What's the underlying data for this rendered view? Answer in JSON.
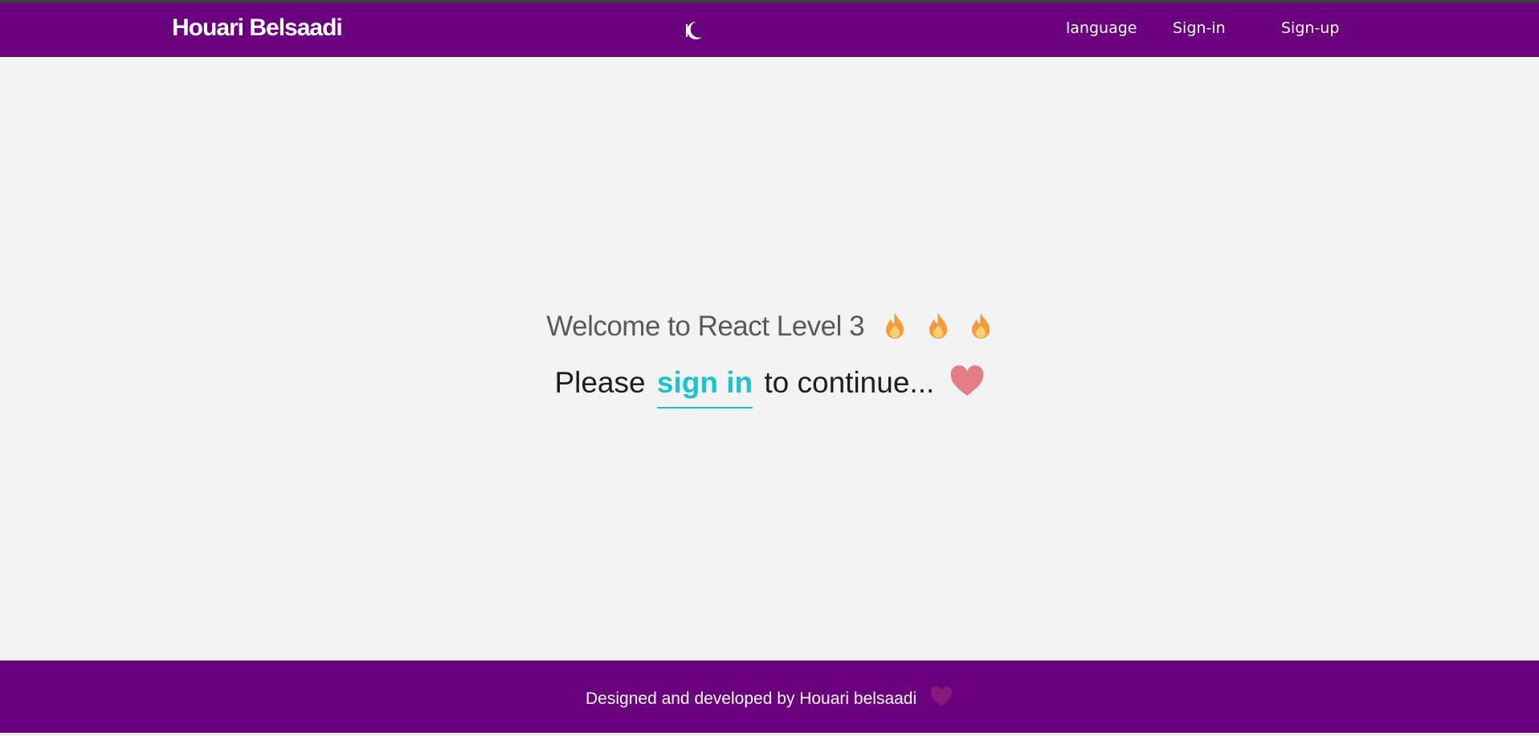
{
  "navbar": {
    "brand": "Houari Belsaadi",
    "theme_toggle_icon": "moon-icon",
    "links": {
      "language": "language",
      "signin": "Sign-in",
      "signup": "Sign-up"
    }
  },
  "main": {
    "welcome_text": "Welcome to React Level 3",
    "welcome_icons": [
      "fire-icon",
      "fire-icon",
      "fire-icon"
    ],
    "please_prefix": "Please",
    "signin_link": "sign in",
    "please_suffix": "to continue...",
    "heart_icon": "heart-icon"
  },
  "footer": {
    "text": "Designed and developed by Houari belsaadi",
    "heart_icon": "heart-icon"
  },
  "colors": {
    "navbar_bg": "#6a007e",
    "page_bg": "#f3f3f3",
    "accent": "#19c3cf",
    "heart_main": "#e57d87",
    "heart_footer": "#8a1a7a",
    "fire": "#f9a04a"
  }
}
